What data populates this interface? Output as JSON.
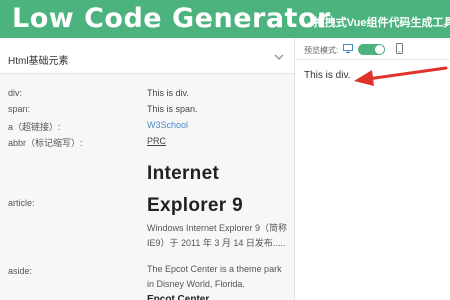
{
  "header": {
    "title": "Low Code Generator",
    "subtitle": "- 拖拽式Vue组件代码生成工具 小"
  },
  "section": {
    "title": "Html基础元素"
  },
  "rows": {
    "div": {
      "label": "div:",
      "value": "This is div."
    },
    "span": {
      "label": "span:",
      "value": "This is span."
    },
    "a": {
      "label": "a（超链接）:",
      "value": "W3School"
    },
    "abbr": {
      "label": "abbr（标记缩写）:",
      "value": "PRC"
    },
    "article": {
      "label": "article:",
      "heading_line1": "Internet",
      "heading_line2": "Explorer 9",
      "text_line1": "Windows Internet Explorer 9（简称",
      "text_line2": "IE9）于 2011 年 3 月 14 日发布....."
    },
    "aside": {
      "label": "aside:",
      "text_line1": "The Epcot Center is a theme park",
      "text_line2": "in Disney World, Florida.",
      "heading": "Epcot Center"
    }
  },
  "preview": {
    "label": "预览模式:",
    "toggle_on": true,
    "content": "This is div."
  },
  "colors": {
    "brand": "#4cb27e",
    "link": "#4a8ac9",
    "annotation_arrow": "#e0312b"
  },
  "icons": {
    "collapse": "chevron-down-icon",
    "desktop": "monitor-icon",
    "mobile": "phone-icon"
  }
}
